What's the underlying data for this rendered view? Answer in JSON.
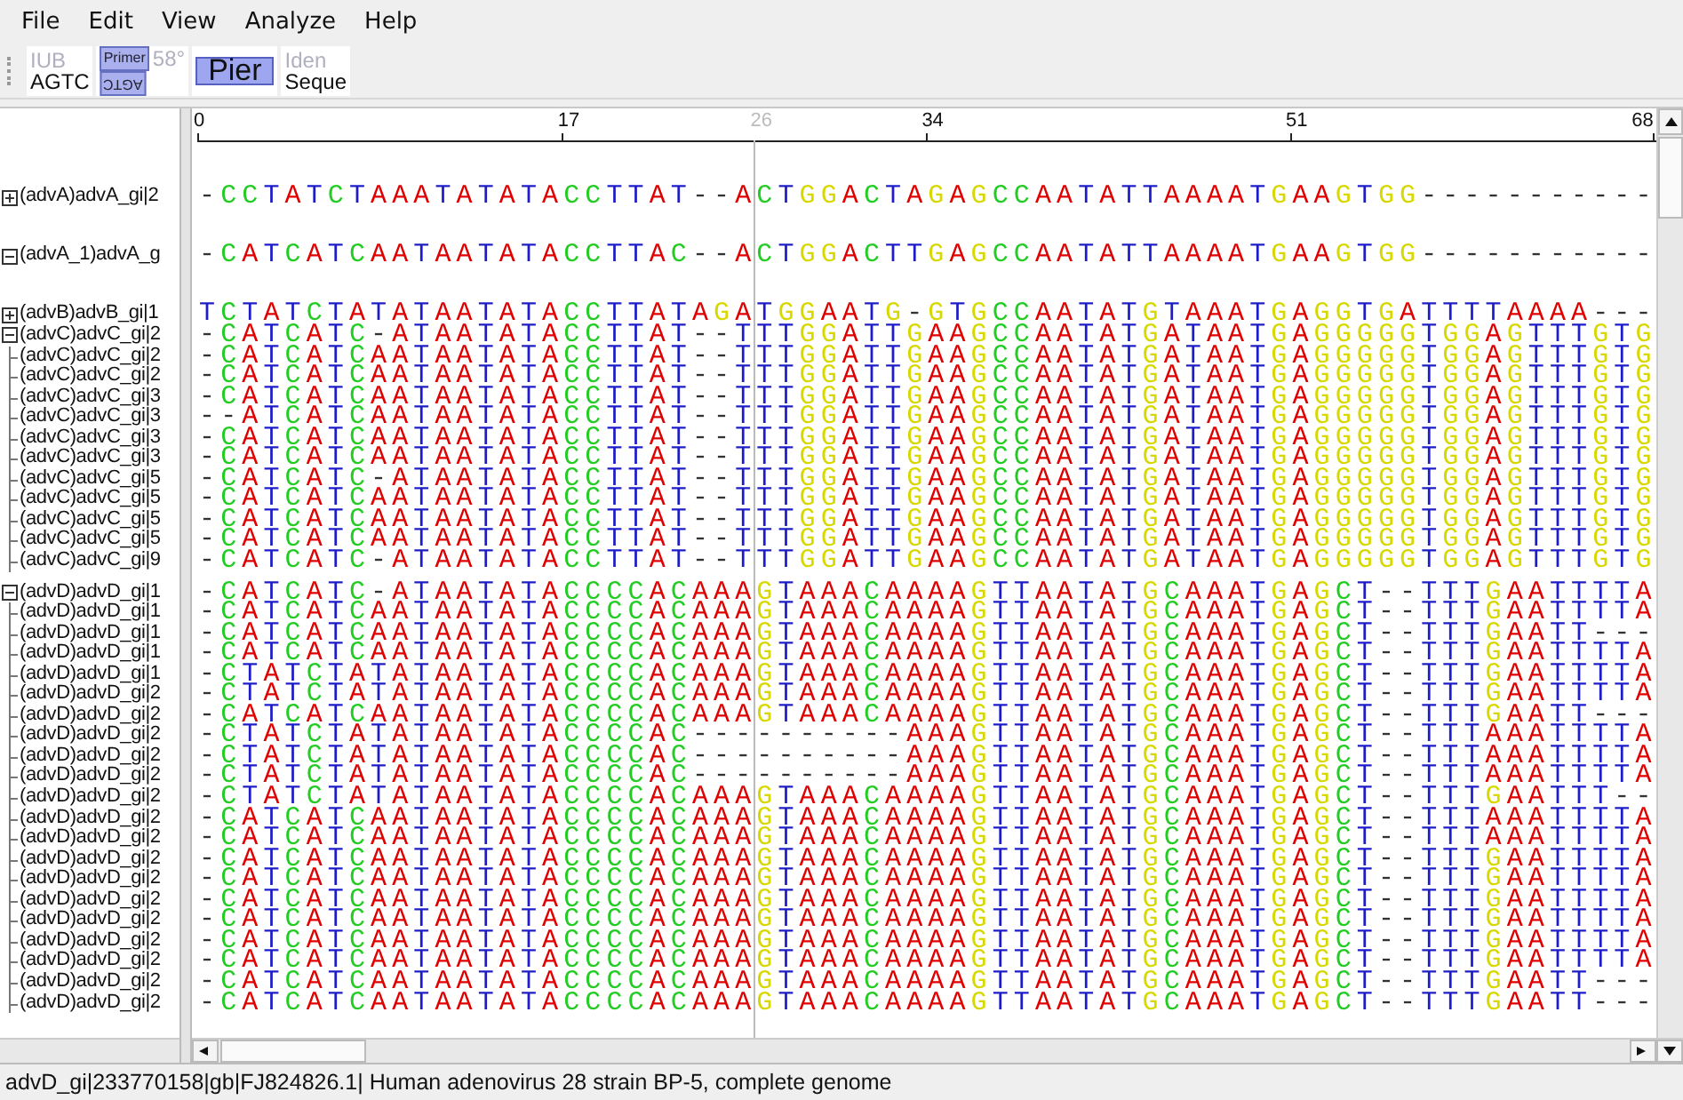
{
  "menu": [
    "File",
    "Edit",
    "View",
    "Analyze",
    "Help"
  ],
  "toolbar": [
    {
      "kind": "stack",
      "top": "IUB",
      "bottom": "AGTC"
    },
    {
      "kind": "primer",
      "top": "Primer",
      "note": "58°",
      "bottom": "AGTC"
    },
    {
      "kind": "big",
      "label": "Pier"
    },
    {
      "kind": "stack",
      "top": "Iden",
      "bottom": "Seque"
    }
  ],
  "ruler": {
    "ticks": [
      "0",
      "17",
      "34",
      "51",
      "68"
    ],
    "cursor": "26"
  },
  "groups": [
    {
      "kind": "single",
      "expanded": false,
      "name": "(advA)advA_gi|2",
      "sequence": "-CCTATCTAAATATATACCTTAT--ACTGGACTAGAGCCAATATTAAAATGAAGTGG-----------"
    },
    {
      "kind": "single",
      "expanded": true,
      "name": "(advA_1)advA_g",
      "sequence": "-CATCATCAATAATATACCTTAC--ACTGGACTTGAGCCAATATTAAAATGAAGTGG-----------"
    },
    {
      "kind": "single",
      "expanded": false,
      "name": "(advB)advB_gi|1",
      "sequence": "TCTATCTATATAATATACCTTATAGATGGAATG-GTGCCAATATGTAAATGAGGTGATTTTAAAA---"
    },
    {
      "kind": "group",
      "expanded": true,
      "name": "(advC)advC_gi|2",
      "sequence": "-CATCATC-ATAATATACCTTAT--TTTGGATTGAAGCCAATATGATAATGAGGGGGTGGAGTTTGTG",
      "children": [
        {
          "name": "(advC)advC_gi|2",
          "sequence": "-CATCATCAATAATATACCTTAT--TTTGGATTGAAGCCAATATGATAATGAGGGGGTGGAGTTTGTG"
        },
        {
          "name": "(advC)advC_gi|2",
          "sequence": "-CATCATCAATAATATACCTTAT--TTTGGATTGAAGCCAATATGATAATGAGGGGGTGGAGTTTGTG"
        },
        {
          "name": "(advC)advC_gi|3",
          "sequence": "-CATCATCAATAATATACCTTAT--TTTGGATTGAAGCCAATATGATAATGAGGGGGTGGAGTTTGTG"
        },
        {
          "name": "(advC)advC_gi|3",
          "sequence": "--ATCATCAATAATATACCTTAT--TTTGGATTGAAGCCAATATGATAATGAGGGGGTGGAGTTTGTG"
        },
        {
          "name": "(advC)advC_gi|3",
          "sequence": "-CATCATCAATAATATACCTTAT--TTTGGATTGAAGCCAATATGATAATGAGGGGGTGGAGTTTGTG"
        },
        {
          "name": "(advC)advC_gi|3",
          "sequence": "-CATCATCAATAATATACCTTAT--TTTGGATTGAAGCCAATATGATAATGAGGGGGTGGAGTTTGTG"
        },
        {
          "name": "(advC)advC_gi|5",
          "sequence": "-CATCATC-ATAATATACCTTAT--TTTGGATTGAAGCCAATATGATAATGAGGGGGTGGAGTTTGTG"
        },
        {
          "name": "(advC)advC_gi|5",
          "sequence": "-CATCATCAATAATATACCTTAT--TTTGGATTGAAGCCAATATGATAATGAGGGGGTGGAGTTTGTG"
        },
        {
          "name": "(advC)advC_gi|5",
          "sequence": "-CATCATCAATAATATACCTTAT--TTTGGATTGAAGCCAATATGATAATGAGGGGGTGGAGTTTGTG"
        },
        {
          "name": "(advC)advC_gi|5",
          "sequence": "-CATCATCAATAATATACCTTAT--TTTGGATTGAAGCCAATATGATAATGAGGGGGTGGAGTTTGTG"
        },
        {
          "name": "(advC)advC_gi|9",
          "sequence": "-CATCATC-ATAATATACCTTAT--TTTGGATTGAAGCCAATATGATAATGAGGGGGTGGAGTTTGTG"
        }
      ]
    },
    {
      "kind": "group",
      "expanded": true,
      "name": "(advD)advD_gi|1",
      "sequence": "-CATCATC-ATAATATACCCCACAAAGTAAACAAAAGTTAATATGCAAATGAGCT--TTTGAATTTTA",
      "children": [
        {
          "name": "(advD)advD_gi|1",
          "sequence": "-CATCATCAATAATATACCCCACAAAGTAAACAAAAGTTAATATGCAAATGAGCT--TTTGAATTTTA"
        },
        {
          "name": "(advD)advD_gi|1",
          "sequence": "-CATCATCAATAATATACCCCACAAAGTAAACAAAAGTTAATATGCAAATGAGCT--TTTGAATT---"
        },
        {
          "name": "(advD)advD_gi|1",
          "sequence": "-CATCATCAATAATATACCCCACAAAGTAAACAAAAGTTAATATGCAAATGAGCT--TTTGAATTTTA"
        },
        {
          "name": "(advD)advD_gi|1",
          "sequence": "-CTATCTATATAATATACCCCACAAAGTAAACAAAAGTTAATATGCAAATGAGCT--TTTGAATTTTA"
        },
        {
          "name": "(advD)advD_gi|2",
          "sequence": "-CTATCTATATAATATACCCCACAAAGTAAACAAAAGTTAATATGCAAATGAGCT--TTTGAATTTTA"
        },
        {
          "name": "(advD)advD_gi|2",
          "sequence": "-CATCATCAATAATATACCCCACAAAGTAAACAAAAGTTAATATGCAAATGAGCT--TTTGAATT---"
        },
        {
          "name": "(advD)advD_gi|2",
          "sequence": "-CTATCTATATAATATACCCCAC----------AAAGTTAATATGCAAATGAGCT--TTTAAATTTTA"
        },
        {
          "name": "(advD)advD_gi|2",
          "sequence": "-CTATCTATATAATATACCCCAC----------AAAGTTAATATGCAAATGAGCT--TTTAAATTTTA"
        },
        {
          "name": "(advD)advD_gi|2",
          "sequence": "-CTATCTATATAATATACCCCAC----------AAAGTTAATATGCAAATGAGCT--TTTAAATTTTA"
        },
        {
          "name": "(advD)advD_gi|2",
          "sequence": "-CTATCTATATAATATACCCCACAAAGTAAACAAAAGTTAATATGCAAATGAGCT--TTTGAATTT--"
        },
        {
          "name": "(advD)advD_gi|2",
          "sequence": "-CATCATCAATAATATACCCCACAAAGTAAACAAAAGTTAATATGCAAATGAGCT--TTTAAATTTTA"
        },
        {
          "name": "(advD)advD_gi|2",
          "sequence": "-CATCATCAATAATATACCCCACAAAGTAAACAAAAGTTAATATGCAAATGAGCT--TTTAAATTTTA"
        },
        {
          "name": "(advD)advD_gi|2",
          "sequence": "-CATCATCAATAATATACCCCACAAAGTAAACAAAAGTTAATATGCAAATGAGCT--TTTGAATTTTA"
        },
        {
          "name": "(advD)advD_gi|2",
          "sequence": "-CATCATCAATAATATACCCCACAAAGTAAACAAAAGTTAATATGCAAATGAGCT--TTTGAATTTTA"
        },
        {
          "name": "(advD)advD_gi|2",
          "sequence": "-CATCATCAATAATATACCCCACAAAGTAAACAAAAGTTAATATGCAAATGAGCT--TTTGAATTTTA"
        },
        {
          "name": "(advD)advD_gi|2",
          "sequence": "-CATCATCAATAATATACCCCACAAAGTAAACAAAAGTTAATATGCAAATGAGCT--TTTGAATTTTA"
        },
        {
          "name": "(advD)advD_gi|2",
          "sequence": "-CATCATCAATAATATACCCCACAAAGTAAACAAAAGTTAATATGCAAATGAGCT--TTTGAATTTTA"
        },
        {
          "name": "(advD)advD_gi|2",
          "sequence": "-CATCATCAATAATATACCCCACAAAGTAAACAAAAGTTAATATGCAAATGAGCT--TTTGAATTTTA"
        },
        {
          "name": "(advD)advD_gi|2",
          "sequence": "-CATCATCAATAATATACCCCACAAAGTAAACAAAAGTTAATATGCAAATGAGCT--TTTGAATT---"
        },
        {
          "name": "(advD)advD_gi|2",
          "sequence": "-CATCATCAATAATATACCCCACAAAGTAAACAAAAGTTAATATGCAAATGAGCT--TTTGAATT---"
        }
      ]
    }
  ],
  "status_bar": "advD_gi|233770158|gb|FJ824826.1| Human adenovirus 28 strain BP-5, complete genome"
}
